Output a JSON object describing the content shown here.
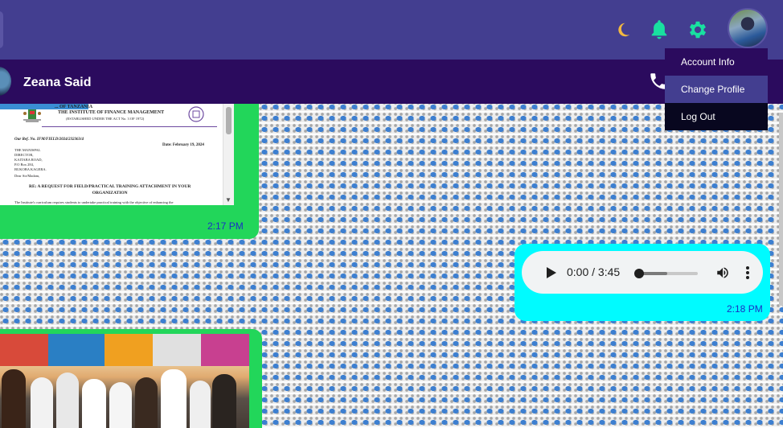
{
  "header": {
    "icons": [
      "moon-icon",
      "bell-icon",
      "gear-icon"
    ],
    "colors": {
      "topbar": "#433e90",
      "chat_header": "#2b0b5e",
      "moon": "#f3b840",
      "bell": "#19e0a0"
    }
  },
  "profile_menu": {
    "items": [
      {
        "label": "Account Info"
      },
      {
        "label": "Change Profile"
      },
      {
        "label": "Log Out"
      }
    ]
  },
  "chat": {
    "contact_name": "Zeana Said",
    "messages": [
      {
        "type": "document",
        "time": "2:17 PM",
        "document": {
          "header_line1": "... OF TANZANIA",
          "header_line2": "ENGE O CHUO KA FEDHA",
          "institute": "THE INSTITUTE OF FINANCE MANAGEMENT",
          "established": "(ESTABLISHED UNDER THE ACT No. 3 OF 1972)",
          "ref": "Our Ref. No. IFM/FIELD/2024/232363/4",
          "date": "Date: February 19, 2024",
          "address": "THE MANISPAL\nDIRECTOR,\nKAITABA ROAD,\nP.O Box 284,\nBUKOBA KAGERA.",
          "salutation": "Dear Sir/Madam,",
          "subject": "RE: A REQUEST FOR FIELD/PRACTICAL TRAINING ATTACHMENT IN YOUR\nORGANIZATION",
          "body_start": "The Institute's curriculum requires students to undertake practical training with the objective of enhancing the"
        },
        "bubble_color": "#22d65a"
      },
      {
        "type": "audio",
        "time": "2:18 PM",
        "audio_time": "0:00 / 3:45",
        "bubble_color": "#00fbff"
      },
      {
        "type": "image",
        "bubble_color": "#22d65a"
      }
    ]
  }
}
